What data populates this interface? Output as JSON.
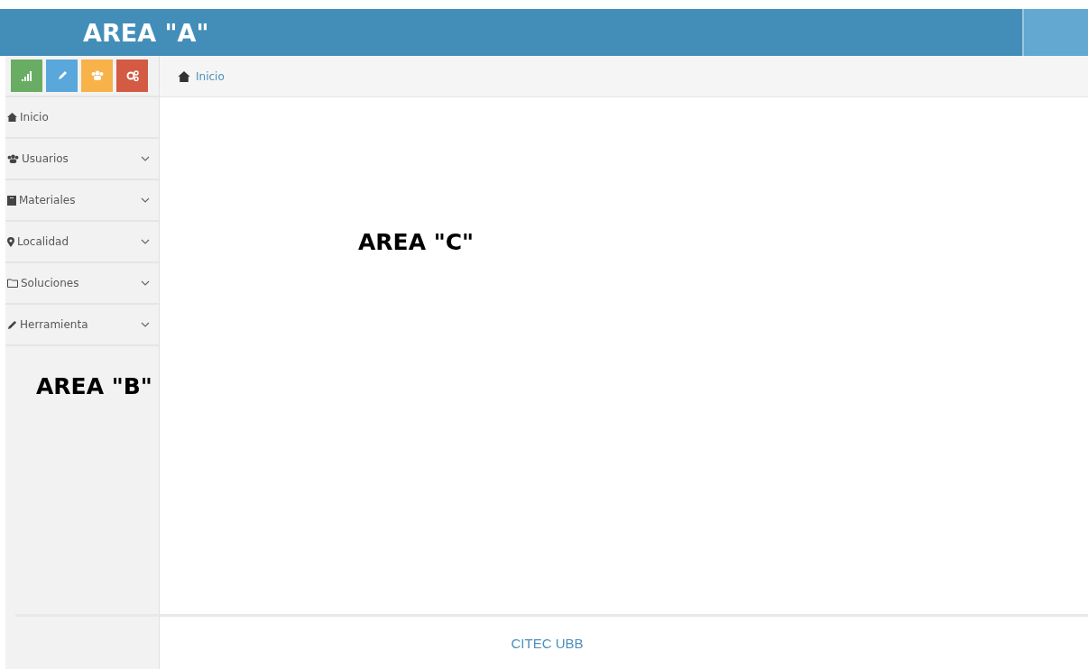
{
  "header": {
    "label": "AREA \"A\""
  },
  "shortcuts": [
    {
      "kind": "chart",
      "color": "#68ad63"
    },
    {
      "kind": "pencil",
      "color": "#5aa7dc"
    },
    {
      "kind": "users",
      "color": "#f8b24a"
    },
    {
      "kind": "gears",
      "color": "#d35a43"
    }
  ],
  "breadcrumb": {
    "label": "Inicio"
  },
  "menu": [
    {
      "label": "Inicio",
      "kind": "home",
      "expandable": false
    },
    {
      "label": "Usuarios",
      "kind": "users",
      "expandable": true
    },
    {
      "label": "Materiales",
      "kind": "book",
      "expandable": true
    },
    {
      "label": "Localidad",
      "kind": "pin",
      "expandable": true
    },
    {
      "label": "Soluciones",
      "kind": "folder",
      "expandable": true
    },
    {
      "label": "Herramienta",
      "kind": "pencil",
      "expandable": true
    }
  ],
  "sidebar_label": "AREA \"B\"",
  "content_label": "AREA \"C\"",
  "footer": "CITEC UBB"
}
